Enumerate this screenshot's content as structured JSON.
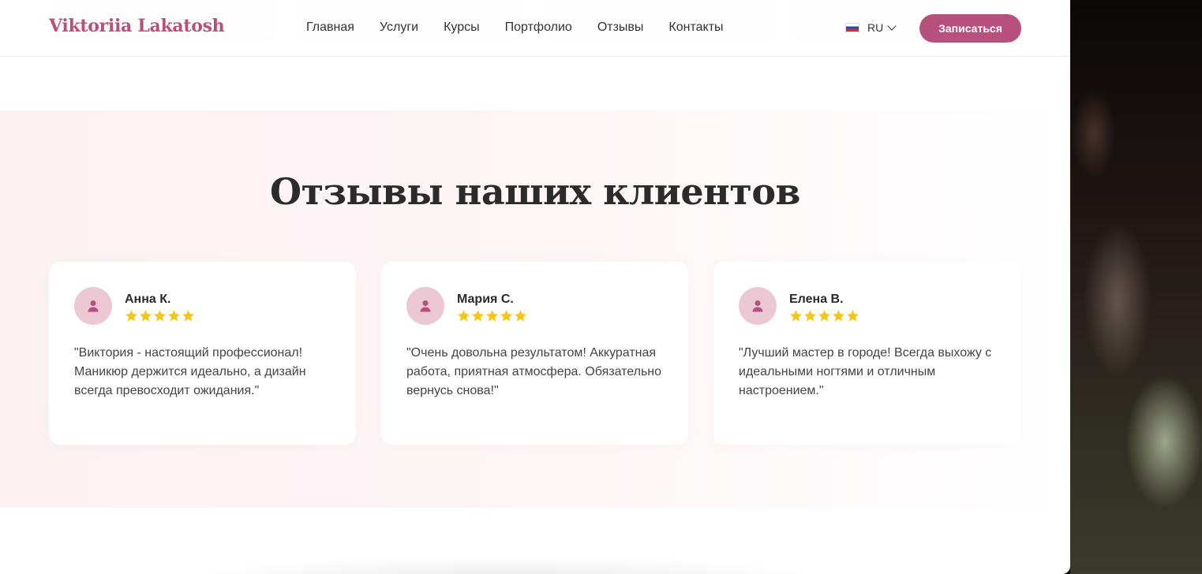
{
  "header": {
    "logo": "Viktoriia Lakatosh",
    "nav": [
      "Главная",
      "Услуги",
      "Курсы",
      "Портфолио",
      "Отзывы",
      "Контакты"
    ],
    "language": "RU",
    "cta": "Записаться"
  },
  "reviews": {
    "title": "Отзывы наших клиентов",
    "items": [
      {
        "name": "Анна К.",
        "rating": 5,
        "text": "\"Виктория - настоящий профессионал! Маникюр держится идеально, а дизайн всегда превосходит ожидания.\""
      },
      {
        "name": "Мария С.",
        "rating": 5,
        "text": "\"Очень довольна результатом! Аккуратная работа, приятная атмосфера. Обязательно вернусь снова!\""
      },
      {
        "name": "Елена В.",
        "rating": 5,
        "text": "\"Лучший мастер в городе! Всегда выхожу с идеальными ногтями и отличным настроением.\""
      }
    ]
  },
  "colors": {
    "brand": "#b8507e",
    "star": "#f5c518",
    "avatar_bg": "#ecc7d4"
  },
  "icons": {
    "language_flag": "russia-flag-icon",
    "avatar": "user-icon",
    "rating": "star-icon",
    "dropdown": "chevron-down-icon"
  }
}
